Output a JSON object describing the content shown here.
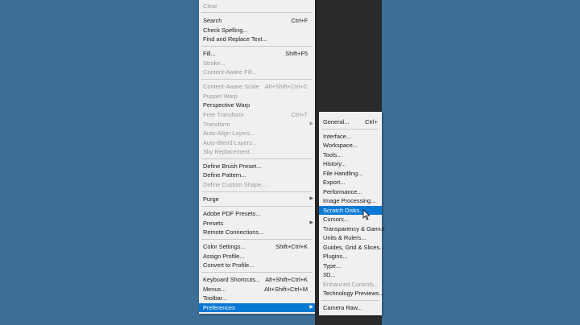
{
  "main_menu": {
    "items": [
      {
        "label": "Clear",
        "shortcut": "",
        "disabled": true
      },
      {
        "label": "Search",
        "shortcut": "Ctrl+F"
      },
      {
        "label": "Check Spelling...",
        "shortcut": ""
      },
      {
        "label": "Find and Replace Text...",
        "shortcut": ""
      },
      {
        "label": "Fill...",
        "shortcut": "Shift+F5"
      },
      {
        "label": "Stroke...",
        "shortcut": "",
        "disabled": true
      },
      {
        "label": "Content-Aware Fill...",
        "shortcut": "",
        "disabled": true
      },
      {
        "label": "Content-Aware Scale",
        "shortcut": "Alt+Shift+Ctrl+C",
        "disabled": true
      },
      {
        "label": "Puppet Warp",
        "shortcut": "",
        "disabled": true
      },
      {
        "label": "Perspective Warp",
        "shortcut": ""
      },
      {
        "label": "Free Transform",
        "shortcut": "Ctrl+T",
        "disabled": true
      },
      {
        "label": "Transform",
        "shortcut": "",
        "disabled": true
      },
      {
        "label": "Auto-Align Layers...",
        "shortcut": "",
        "disabled": true
      },
      {
        "label": "Auto-Blend Layers...",
        "shortcut": "",
        "disabled": true
      },
      {
        "label": "Sky Replacement...",
        "shortcut": "",
        "disabled": true
      },
      {
        "label": "Define Brush Preset...",
        "shortcut": ""
      },
      {
        "label": "Define Pattern...",
        "shortcut": ""
      },
      {
        "label": "Define Custom Shape...",
        "shortcut": "",
        "disabled": true
      },
      {
        "label": "Purge",
        "shortcut": ""
      },
      {
        "label": "Adobe PDF Presets...",
        "shortcut": ""
      },
      {
        "label": "Presets",
        "shortcut": ""
      },
      {
        "label": "Remote Connections...",
        "shortcut": ""
      },
      {
        "label": "Color Settings...",
        "shortcut": "Shift+Ctrl+K"
      },
      {
        "label": "Assign Profile...",
        "shortcut": ""
      },
      {
        "label": "Convert to Profile...",
        "shortcut": ""
      },
      {
        "label": "Keyboard Shortcuts...",
        "shortcut": "Alt+Shift+Ctrl+K"
      },
      {
        "label": "Menus...",
        "shortcut": "Alt+Shift+Ctrl+M"
      },
      {
        "label": "Toolbar...",
        "shortcut": ""
      },
      {
        "label": "Preferences",
        "shortcut": "",
        "selected": true
      }
    ]
  },
  "preferences_submenu": {
    "items": [
      {
        "label": "General...",
        "shortcut": "Ctrl+"
      },
      {
        "label": "Interface..."
      },
      {
        "label": "Workspace..."
      },
      {
        "label": "Tools..."
      },
      {
        "label": "History..."
      },
      {
        "label": "File Handling..."
      },
      {
        "label": "Export..."
      },
      {
        "label": "Performance..."
      },
      {
        "label": "Image Processing..."
      },
      {
        "label": "Scratch Disks...",
        "selected": true
      },
      {
        "label": "Cursors..."
      },
      {
        "label": "Transparency & Gamut"
      },
      {
        "label": "Units & Rulers..."
      },
      {
        "label": "Guides, Grid & Slices..."
      },
      {
        "label": "Plugins..."
      },
      {
        "label": "Type..."
      },
      {
        "label": "3D..."
      },
      {
        "label": "Enhanced Controls...",
        "disabled": true
      },
      {
        "label": "Technology Previews..."
      },
      {
        "label": "Camera Raw..."
      }
    ]
  },
  "colors": {
    "background": "#3d6e96",
    "menu_bg": "#f0f0f0",
    "highlight": "#0a79d3",
    "disabled_text": "#9a9a9a"
  }
}
